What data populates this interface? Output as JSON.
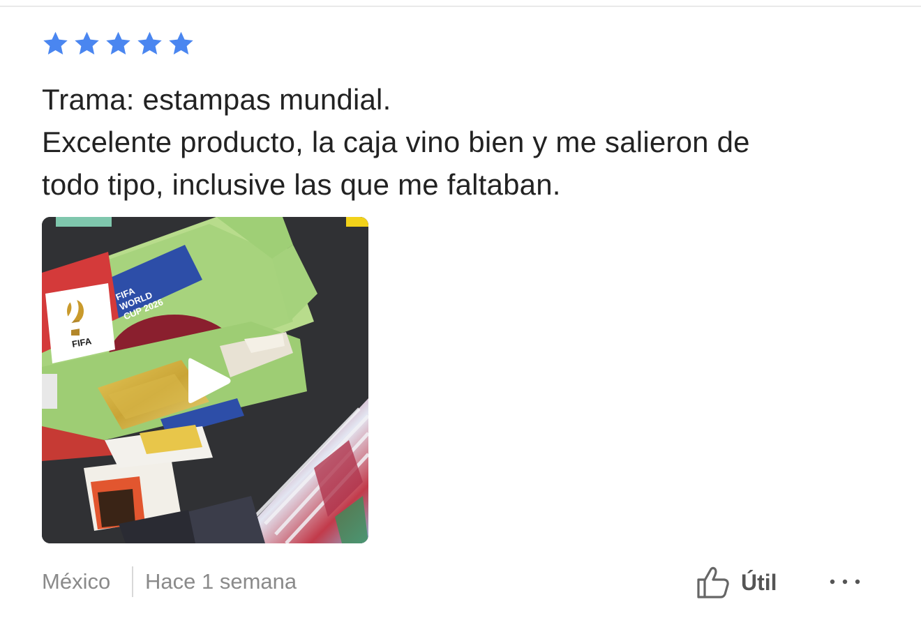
{
  "review": {
    "rating": 5,
    "rating_max": 5,
    "star_color": "#4a86f0",
    "lines": [
      "Trama: estampas mundial.",
      "Excelente producto, la caja vino bien y me salieron de",
      "todo tipo, inclusive las que me faltaban."
    ],
    "media": {
      "type": "video",
      "box_text": [
        "FIFA",
        "WORLD",
        "CUP 2026"
      ],
      "logo_text": "FIFA"
    },
    "footer": {
      "country": "México",
      "date": "Hace 1 semana",
      "helpful_label": "Útil"
    }
  },
  "icons": {
    "star": "star-icon",
    "play": "play-icon",
    "helpful": "thumbs-up-icon",
    "more": "more-options-icon"
  }
}
